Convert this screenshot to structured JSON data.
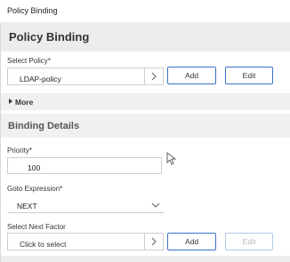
{
  "window": {
    "title": "Policy Binding"
  },
  "panel": {
    "title": "Policy Binding"
  },
  "select_policy": {
    "label": "Select Policy*",
    "value": "LDAP-policy",
    "add_label": "Add",
    "edit_label": "Edit"
  },
  "more": {
    "label": "More"
  },
  "binding_details": {
    "title": "Binding Details",
    "priority_label": "Priority*",
    "priority_value": "100",
    "goto_label": "Goto Expression*",
    "goto_value": "NEXT"
  },
  "next_factor": {
    "label": "Select Next Factor",
    "placeholder": "Click to select",
    "add_label": "Add",
    "edit_label": "Edit"
  },
  "colors": {
    "accent": "#3b6fc9",
    "panel_bg": "#ececec",
    "section_bg": "#f0f0f0"
  },
  "icons": {
    "chevron_right": "chevron-right-icon",
    "chevron_down": "chevron-down-icon",
    "expand": "triangle-right-icon",
    "cursor": "mouse-pointer-icon"
  }
}
